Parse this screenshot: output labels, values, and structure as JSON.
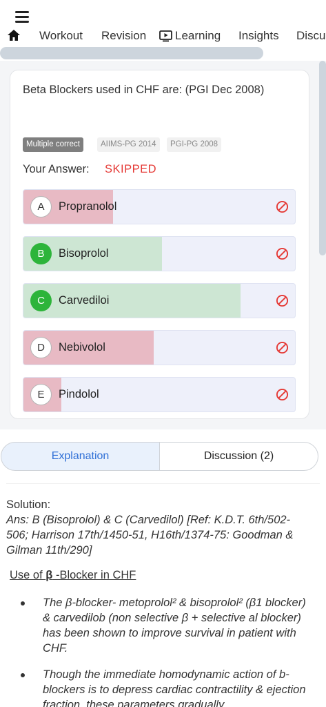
{
  "nav": {
    "tabs": [
      "Workout",
      "Revision",
      "Learning",
      "Insights",
      "Discu"
    ]
  },
  "question": {
    "text": "Beta Blockers used in CHF are: (PGI Dec 2008)",
    "tags": [
      "Multiple correct",
      "AIIMS-PG 2014",
      "PGI-PG 2008"
    ],
    "answer_label": "Your Answer:",
    "answer_value": "SKIPPED"
  },
  "options": [
    {
      "letter": "A",
      "text": "Propranolol",
      "status": "incorrect",
      "response_share": 0.33
    },
    {
      "letter": "B",
      "text": "Bisoprolol",
      "status": "correct",
      "response_share": 0.51
    },
    {
      "letter": "C",
      "text": "Carvediloi",
      "status": "correct",
      "response_share": 0.8
    },
    {
      "letter": "D",
      "text": "Nebivolol",
      "status": "incorrect",
      "response_share": 0.48
    },
    {
      "letter": "E",
      "text": "Pindolol",
      "status": "incorrect",
      "response_share": 0.14
    }
  ],
  "segment": {
    "explanation": "Explanation",
    "discussion": "Discussion (2)"
  },
  "explanation": {
    "solution_label": "Solution:",
    "answer": "Ans: B (Bisoprolol) & C (Carvedilol) [Ref: K.D.T. 6th/502- 506; Harrison 17th/1450-51, H16th/1374-75: Goodman & Gilman 11th/290]",
    "heading_pre": "Use of ",
    "heading_symbol": "β",
    "heading_post": " -Blocker in CHF",
    "bullets": [
      "The β-blocker- metoprolol² & bisoprolol² (β1 blocker) & carvedilob (non selective β + selective al blocker) has been shown to improve survival in patient with CHF.",
      "Though the immediate homodynamic action of b-blockers is to depress cardiac contractility & ejection fraction, these parameters gradually"
    ]
  },
  "colors": {
    "correct_fill": "#cde6d3",
    "incorrect_fill": "#e8bac4",
    "correct_badge": "#2db43a",
    "skipped_text": "#e53935",
    "accent": "#2f6fd6"
  }
}
